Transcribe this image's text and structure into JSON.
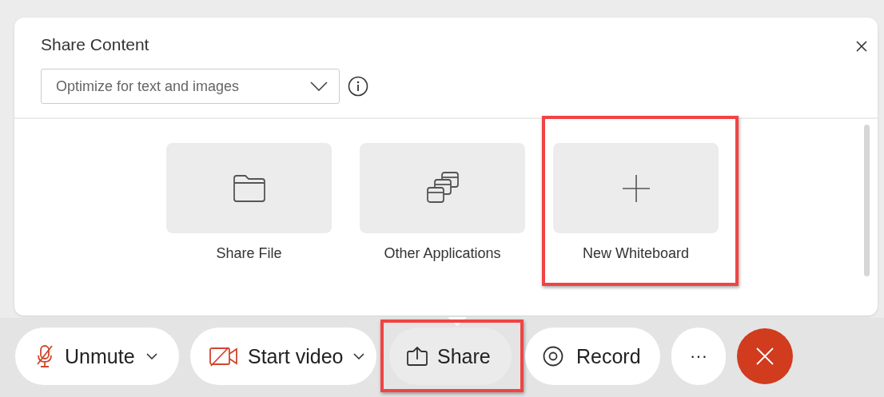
{
  "dialog": {
    "title": "Share Content",
    "optimize_dropdown": {
      "value": "Optimize for text and images"
    },
    "tiles": [
      {
        "kind": "file",
        "label": "Share File",
        "highlighted": false
      },
      {
        "kind": "apps",
        "label": "Other Applications",
        "highlighted": false
      },
      {
        "kind": "whiteboard",
        "label": "New Whiteboard",
        "highlighted": true
      }
    ]
  },
  "toolbar": [
    {
      "kind": "mic",
      "label": "Unmute",
      "has_menu": true,
      "selected": false,
      "highlighted": false
    },
    {
      "kind": "video",
      "label": "Start video",
      "has_menu": true,
      "selected": false,
      "highlighted": false
    },
    {
      "kind": "share",
      "label": "Share",
      "has_menu": false,
      "selected": true,
      "highlighted": true
    },
    {
      "kind": "record",
      "label": "Record",
      "has_menu": false,
      "selected": false,
      "highlighted": false
    },
    {
      "kind": "more",
      "label": "···",
      "has_menu": false,
      "selected": false,
      "highlighted": false
    },
    {
      "kind": "end",
      "has_menu": false,
      "selected": false,
      "highlighted": false
    }
  ]
}
